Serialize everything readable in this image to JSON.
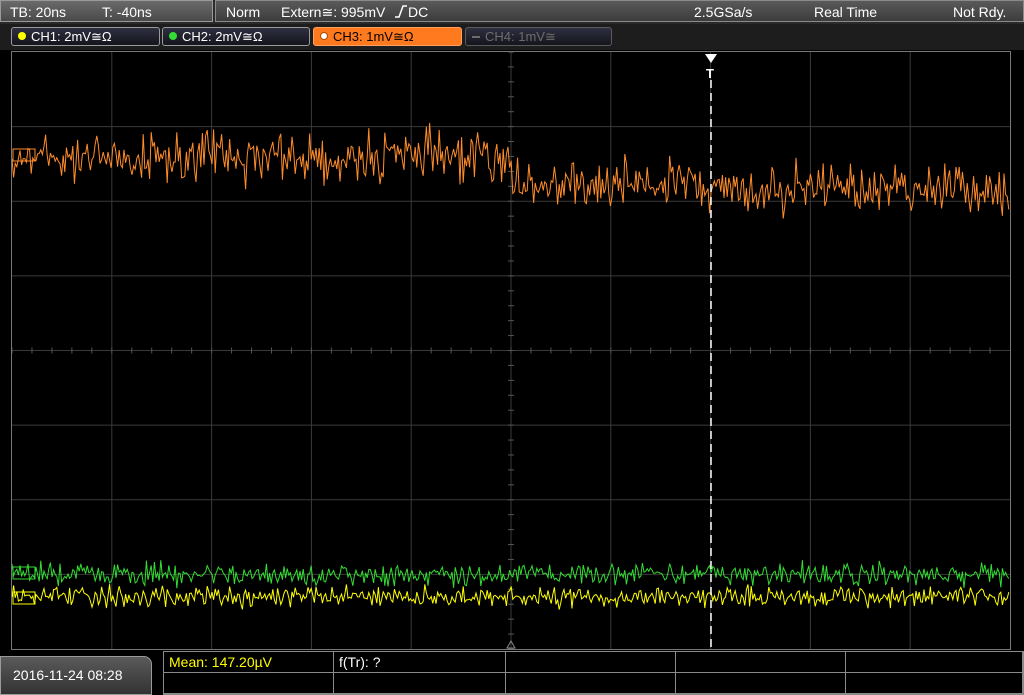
{
  "top": {
    "timebase": "TB: 20ns",
    "trigger_time": "T: -40ns",
    "mode": "Norm",
    "trigger_source": "Extern≅: 995mV",
    "trigger_slope_icon": "rising-edge-icon",
    "trigger_coupling": "DC",
    "sample_rate": "2.5GSa/s",
    "acquisition": "Real Time",
    "status": "Not Rdy."
  },
  "channels": [
    {
      "label": "CH1: 2mV≅Ω",
      "color": "#ffff00",
      "state": "on"
    },
    {
      "label": "CH2: 2mV≅Ω",
      "color": "#33dd33",
      "state": "on"
    },
    {
      "label": "CH3: 1mV≅Ω",
      "color": "#ff8c2a",
      "state": "selected"
    },
    {
      "label": "CH4: 1mV≅",
      "color": "#6d6d6d",
      "state": "off"
    }
  ],
  "display": {
    "grid": "10x8",
    "trigger_marker": "T",
    "trace_colors": {
      "ch1": "#ffff00",
      "ch2": "#33dd33",
      "ch3": "#ff8c2a"
    }
  },
  "bottom": {
    "datetime": "2016-11-24 08:28",
    "measurement1": "Mean: 147.20µV",
    "measurement2": "f(Tr): ?"
  }
}
